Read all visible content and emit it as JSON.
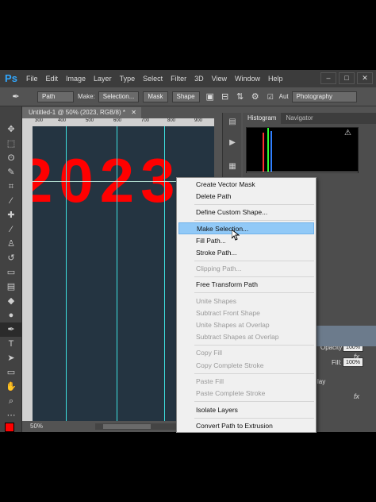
{
  "app": {
    "logo": "Ps",
    "menu": [
      "File",
      "Edit",
      "Image",
      "Layer",
      "Type",
      "Select",
      "Filter",
      "3D",
      "View",
      "Window",
      "Help"
    ],
    "window_controls": [
      "–",
      "□",
      "✕"
    ]
  },
  "options": {
    "mode": "Path",
    "make_label": "Make:",
    "selection_btn": "Selection...",
    "mask_btn": "Mask",
    "shape_btn": "Shape",
    "auto_label": "Aut",
    "workspace": "Photography"
  },
  "document": {
    "tab_title": "Untitled-1 @ 50% (2023, RGB/8) *",
    "close": "✕",
    "canvas_text": "2023",
    "zoom": "50%",
    "ruler_ticks": [
      "300",
      "400",
      "500",
      "600",
      "700",
      "800",
      "900"
    ]
  },
  "panels": {
    "tabs": [
      "Histogram",
      "Navigator"
    ],
    "opacity_label": "Opacity:",
    "opacity_value": "100%",
    "fill_label": "Fill:",
    "fill_value": "100%",
    "fx": "fx",
    "partial_label": "lay"
  },
  "context_menu": {
    "items": [
      {
        "label": "Create Vector Mask",
        "enabled": true
      },
      {
        "label": "Delete Path",
        "enabled": true
      },
      {
        "label": "Define Custom Shape...",
        "enabled": true
      },
      {
        "label": "Make Selection...",
        "enabled": true,
        "highlighted": true
      },
      {
        "label": "Fill Path...",
        "enabled": true
      },
      {
        "label": "Stroke Path...",
        "enabled": true
      },
      {
        "label": "Clipping Path...",
        "enabled": false
      },
      {
        "label": "Free Transform Path",
        "enabled": true
      },
      {
        "label": "Unite Shapes",
        "enabled": false
      },
      {
        "label": "Subtract Front Shape",
        "enabled": false
      },
      {
        "label": "Unite Shapes at Overlap",
        "enabled": false
      },
      {
        "label": "Subtract Shapes at Overlap",
        "enabled": false
      },
      {
        "label": "Copy Fill",
        "enabled": false
      },
      {
        "label": "Copy Complete Stroke",
        "enabled": false
      },
      {
        "label": "Paste Fill",
        "enabled": false
      },
      {
        "label": "Paste Complete Stroke",
        "enabled": false
      },
      {
        "label": "Isolate Layers",
        "enabled": true
      },
      {
        "label": "Convert Path to Extrusion",
        "enabled": true
      }
    ]
  },
  "colors": {
    "canvas_bg": "#243441",
    "text_red": "#ff0000",
    "guide": "#3ee0e0",
    "highlight": "#91c9f7"
  }
}
